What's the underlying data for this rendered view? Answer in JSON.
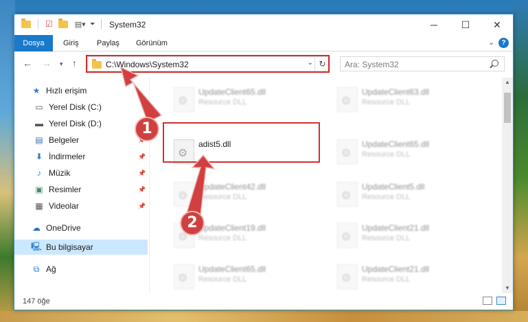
{
  "window": {
    "title": "System32",
    "controls": {
      "minimize": "─",
      "maximize": "☐",
      "close": "✕"
    }
  },
  "ribbon": {
    "tabs": [
      "Dosya",
      "Giriş",
      "Paylaş",
      "Görünüm"
    ],
    "help": "?"
  },
  "nav": {
    "address": "C:\\Windows\\System32",
    "search_placeholder": "Ara: System32"
  },
  "sidebar": {
    "items": [
      {
        "label": "Hızlı erişim",
        "icon": "star-icon",
        "pinned": false
      },
      {
        "label": "Yerel Disk (C:)",
        "icon": "drive-icon",
        "pinned": false
      },
      {
        "label": "Yerel Disk (D:)",
        "icon": "drive-icon",
        "pinned": false
      },
      {
        "label": "Belgeler",
        "icon": "documents-icon",
        "pinned": true
      },
      {
        "label": "İndirmeler",
        "icon": "download-icon",
        "pinned": true
      },
      {
        "label": "Müzik",
        "icon": "music-icon",
        "pinned": true
      },
      {
        "label": "Resimler",
        "icon": "pictures-icon",
        "pinned": true
      },
      {
        "label": "Videolar",
        "icon": "video-icon",
        "pinned": true
      },
      {
        "label": "OneDrive",
        "icon": "cloud-icon",
        "pinned": false
      },
      {
        "label": "Bu bilgisayar",
        "icon": "computer-icon",
        "pinned": false,
        "selected": true
      },
      {
        "label": "Ağ",
        "icon": "network-icon",
        "pinned": false
      }
    ]
  },
  "files": [
    {
      "name": "UpdateClient65.dll",
      "type": "Resource DLL"
    },
    {
      "name": "UpdateClient63.dll",
      "type": "Resource DLL"
    },
    {
      "name": "adist5.dll",
      "type": ""
    },
    {
      "name": "UpdateClient65.dll",
      "type": "Resource DLL"
    },
    {
      "name": "UpdateClient42.dll",
      "type": "Resource DLL"
    },
    {
      "name": "UpdateClient5.dll",
      "type": "Resource DLL"
    },
    {
      "name": "UpdateClient19.dll",
      "type": "Resource DLL"
    },
    {
      "name": "UpdateClient21.dll",
      "type": "Resource DLL"
    },
    {
      "name": "UpdateClient65.dll",
      "type": "Resource DLL"
    },
    {
      "name": "UpdateClient21.dll",
      "type": "Resource DLL"
    }
  ],
  "status": {
    "count": "147 öğe"
  },
  "annotations": {
    "step1": "1",
    "step2": "2",
    "color": "#d12f2f"
  }
}
